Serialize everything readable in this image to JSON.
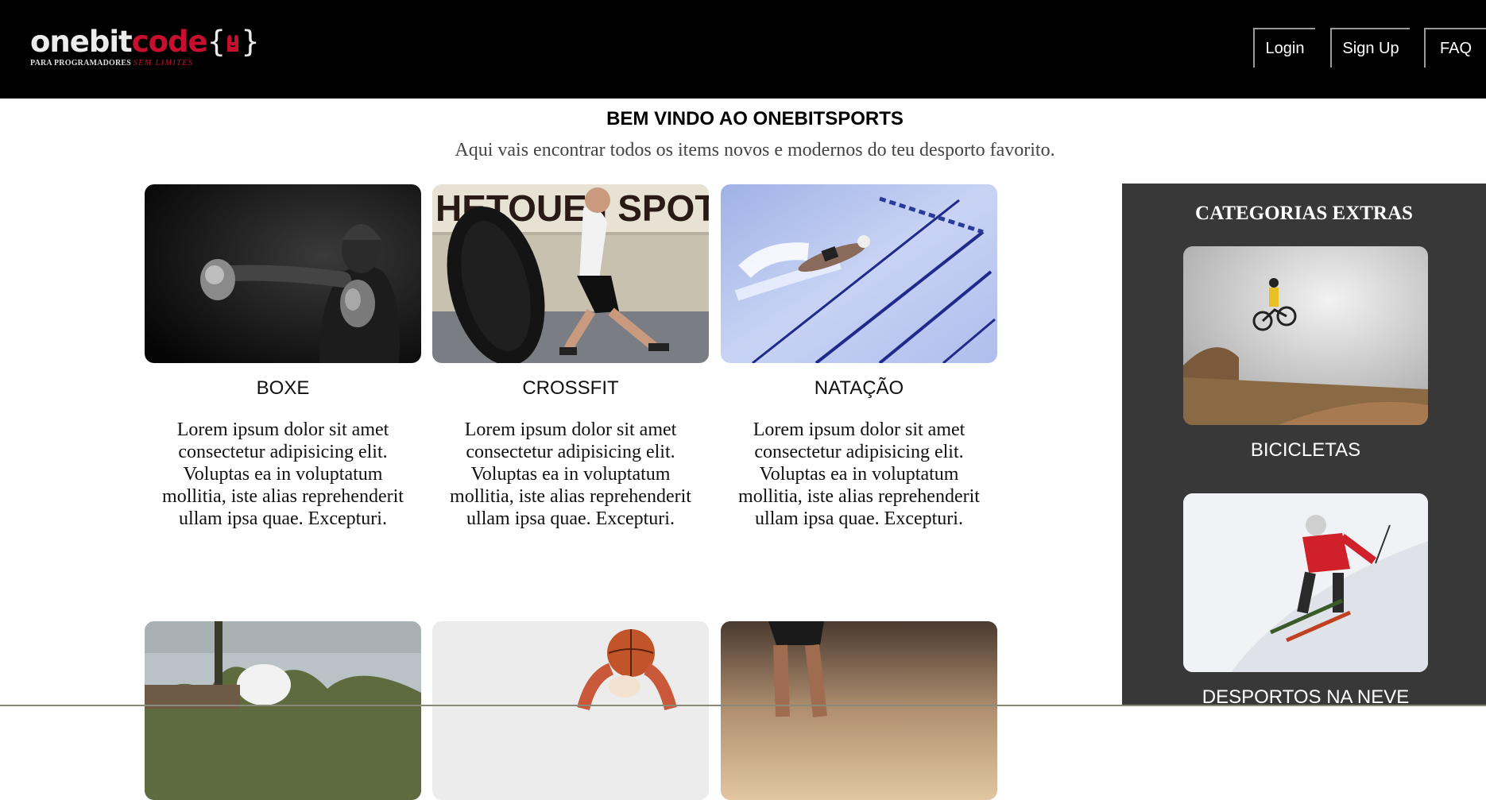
{
  "header": {
    "logo": {
      "one": "one",
      "bit": "bit",
      "code": "code",
      "brace_open": "{",
      "brace_close": "}",
      "tagline": "PARA PROGRAMADORES",
      "tagline_accent": "SEM LIMITES"
    },
    "nav": [
      {
        "label": "Login"
      },
      {
        "label": "Sign Up"
      },
      {
        "label": "FAQ"
      }
    ]
  },
  "welcome": {
    "title": "BEM VINDO AO ONEBITSPORTS",
    "subtitle": "Aqui vais encontrar todos os items novos e modernos do teu desporto favorito."
  },
  "cards": [
    {
      "title": "BOXE",
      "text": "Lorem ipsum dolor sit amet consectetur adipisicing elit. Voluptas ea in voluptatum mollitia, iste alias reprehenderit ullam ipsa quae. Excepturi."
    },
    {
      "title": "CROSSFIT",
      "text": "Lorem ipsum dolor sit amet consectetur adipisicing elit. Voluptas ea in voluptatum mollitia, iste alias reprehenderit ullam ipsa quae. Excepturi.",
      "photo_sign": "HETOUE I SPOT"
    },
    {
      "title": "NATAÇÃO",
      "text": "Lorem ipsum dolor sit amet consectetur adipisicing elit. Voluptas ea in voluptatum mollitia, iste alias reprehenderit ullam ipsa quae. Excepturi."
    }
  ],
  "sidebar": {
    "heading": "CATEGORIAS EXTRAS",
    "items": [
      {
        "label": "BICICLETAS"
      },
      {
        "label": "DESPORTOS NA NEVE"
      }
    ]
  },
  "icons": {
    "logo": "rock-hand-icon"
  },
  "colors": {
    "header_bg": "#000000",
    "accent": "#c8102e",
    "sidebar_bg": "#383838"
  }
}
